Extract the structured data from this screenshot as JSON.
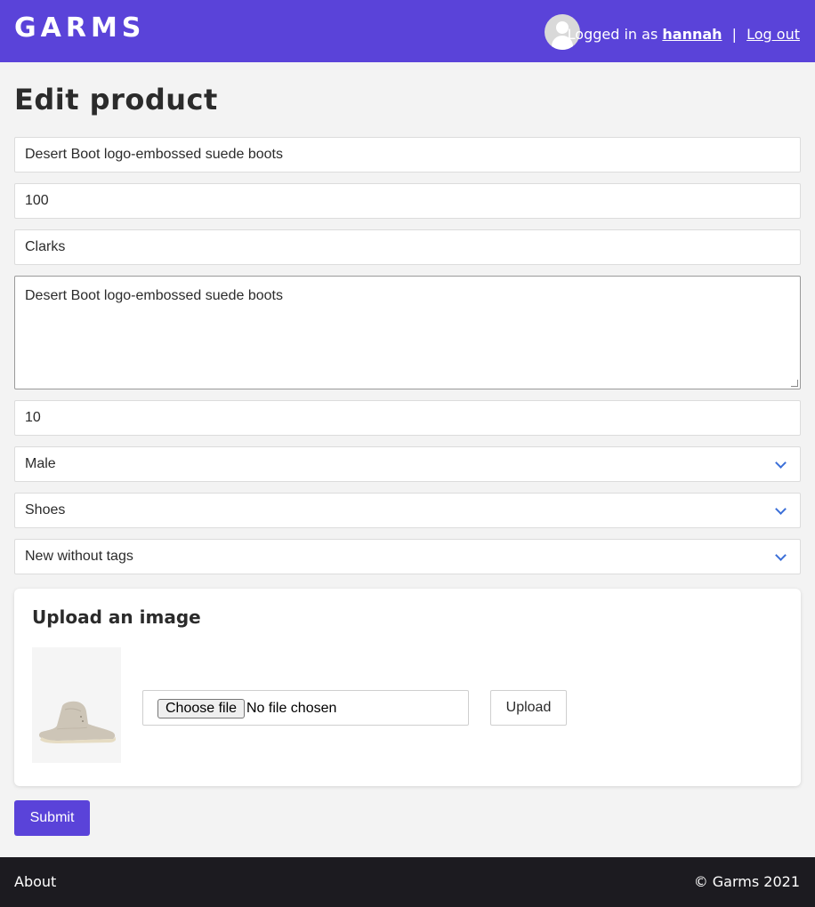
{
  "header": {
    "logo": "GARMS",
    "logged_in_prefix": "Logged in as",
    "username": "hannah",
    "separator": "|",
    "logout_label": "Log out",
    "brand_color": "#5a43d9"
  },
  "page": {
    "title": "Edit product"
  },
  "form": {
    "name_value": "Desert Boot logo-embossed suede boots",
    "price_value": "100",
    "brand_value": "Clarks",
    "description_value": "Desert Boot logo-embossed suede boots",
    "size_value": "10",
    "gender_selected": "Male",
    "category_selected": "Shoes",
    "condition_selected": "New without tags"
  },
  "upload": {
    "title": "Upload an image",
    "choose_file_label": "Choose file",
    "no_file_text": "No file chosen",
    "upload_label": "Upload",
    "thumbnail_icon": "suede-boot-image"
  },
  "submit_label": "Submit",
  "footer": {
    "about_label": "About",
    "copyright": "© Garms 2021"
  }
}
